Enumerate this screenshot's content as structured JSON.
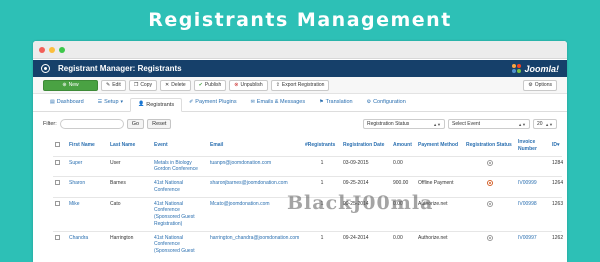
{
  "banner": {
    "title": "Registrants Management"
  },
  "window": {
    "header_title": "Registrant Manager: Registrants",
    "brand": "Joomla!"
  },
  "toolbar": {
    "new": "New",
    "edit": "Edit",
    "copy": "Copy",
    "delete": "Delete",
    "publish": "Publish",
    "unpublish": "Unpublish",
    "export": "Export Registration",
    "options": "Options"
  },
  "tabs": [
    {
      "label": "Dashboard",
      "icon": "dashboard-icon"
    },
    {
      "label": "Setup",
      "icon": "setup-icon"
    },
    {
      "label": "Registrants",
      "icon": "user-icon"
    },
    {
      "label": "Payment Plugins",
      "icon": "wrench-icon"
    },
    {
      "label": "Emails & Messages",
      "icon": "envelope-icon"
    },
    {
      "label": "Translation",
      "icon": "flag-icon"
    },
    {
      "label": "Configuration",
      "icon": "gear-icon"
    }
  ],
  "filter": {
    "label": "Filter:",
    "search_value": "",
    "go": "Go",
    "reset": "Reset",
    "status_select": "Registration Status",
    "event_select": "Select Event",
    "limit_select": "20"
  },
  "table": {
    "headers": {
      "first_name": "First Name",
      "last_name": "Last Name",
      "event": "Event",
      "email": "Email",
      "registrants": "#Registrants",
      "reg_date": "Registration Date",
      "amount": "Amount",
      "payment": "Payment Method",
      "status": "Registration Status",
      "invoice": "Invoice Number",
      "id": "ID"
    },
    "rows": [
      {
        "first": "Super",
        "last": "User",
        "event": "Metals in Biology Gordon Conference",
        "email": "tuanpn@joomdonation.com",
        "count": "1",
        "date": "03-09-2015",
        "amount": "0.00",
        "payment": "",
        "invoice": "",
        "id": "1284"
      },
      {
        "first": "Sharon",
        "last": "Barnes",
        "event": "41st National Conference",
        "email": "sharonjbarnes@joomdonation.com",
        "count": "1",
        "date": "09-25-2014",
        "amount": "900.00",
        "payment": "Offline Payment",
        "invoice": "IV00999",
        "id": "1264"
      },
      {
        "first": "Mike",
        "last": "Cato",
        "event": "41st National Conference (Sponsored Guest Registration)",
        "email": "Mcato@joomdonation.com",
        "count": "1",
        "date": "09-25-2014",
        "amount": "0.00",
        "payment": "Authorize.net",
        "invoice": "IV00998",
        "id": "1263"
      },
      {
        "first": "Chandra",
        "last": "Harrington",
        "event": "41st National Conference (Sponsored Guest",
        "email": "harrington_chandra@joomdonation.com",
        "count": "1",
        "date": "09-24-2014",
        "amount": "0.00",
        "payment": "Authorize.net",
        "invoice": "IV00997",
        "id": "1262"
      }
    ]
  },
  "watermark": "BlackJ00mla"
}
